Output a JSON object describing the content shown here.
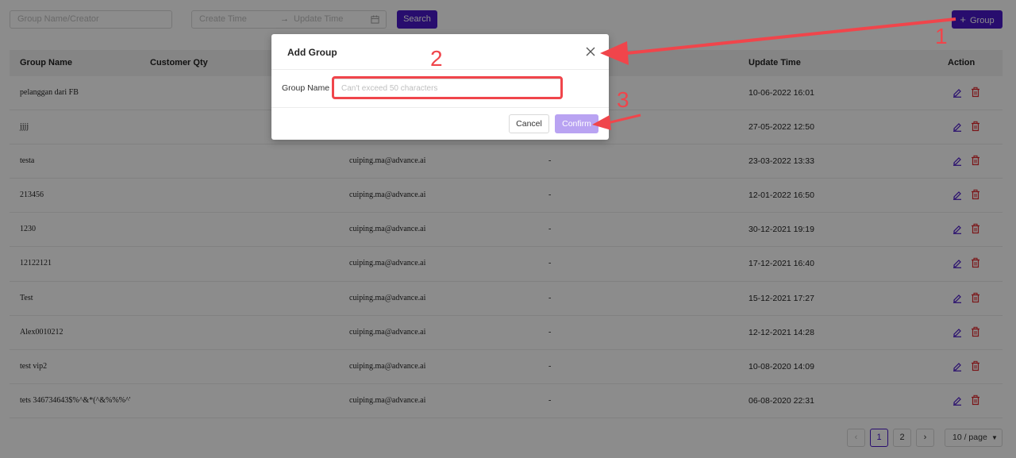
{
  "filters": {
    "name_placeholder": "Group Name/Creator",
    "start_placeholder": "Create Time",
    "separator": "→",
    "end_placeholder": "Update Time",
    "calendar_icon": "calendar-icon",
    "search_label": "Search",
    "add_group_label": "Group",
    "add_icon": "plus-icon"
  },
  "table": {
    "headers": [
      "Group Name",
      "Customer Qty",
      "Update Time",
      "Action"
    ],
    "rows": [
      {
        "name": "pelanggan dari FB",
        "creator": "",
        "remark": "",
        "update_time": "10-06-2022 16:01"
      },
      {
        "name": "jjjj",
        "creator": "",
        "remark": "",
        "update_time": "27-05-2022 12:50"
      },
      {
        "name": "testa",
        "creator": "cuiping.ma@advance.ai",
        "remark": "-",
        "update_time": "23-03-2022 13:33"
      },
      {
        "name": "213456",
        "creator": "cuiping.ma@advance.ai",
        "remark": "-",
        "update_time": "12-01-2022 16:50"
      },
      {
        "name": "1230",
        "creator": "cuiping.ma@advance.ai",
        "remark": "-",
        "update_time": "30-12-2021 19:19"
      },
      {
        "name": "12122121",
        "creator": "cuiping.ma@advance.ai",
        "remark": "-",
        "update_time": "17-12-2021 16:40"
      },
      {
        "name": "Test",
        "creator": "cuiping.ma@advance.ai",
        "remark": "-",
        "update_time": "15-12-2021 17:27"
      },
      {
        "name": "Alex0010212",
        "creator": "cuiping.ma@advance.ai",
        "remark": "-",
        "update_time": "12-12-2021 14:28"
      },
      {
        "name": "test vip2",
        "creator": "cuiping.ma@advance.ai",
        "remark": "-",
        "update_time": "10-08-2020 14:09"
      },
      {
        "name": "tets 346734643$%^&*(^&%%%^'",
        "creator": "cuiping.ma@advance.ai",
        "remark": "-",
        "update_time": "06-08-2020 22:31"
      }
    ],
    "edit_icon": "edit-icon",
    "delete_icon": "trash-icon"
  },
  "pagination": {
    "pages": [
      "1",
      "2"
    ],
    "current": "1",
    "page_size": "10 / page",
    "prev_icon": "chevron-left-icon",
    "next_icon": "chevron-right-icon"
  },
  "modal": {
    "title": "Add Group",
    "field_label": "Group Name",
    "field_placeholder": "Can't exceed 50 characters",
    "cancel_label": "Cancel",
    "confirm_label": "Confirm",
    "close_icon": "close-icon"
  },
  "annotations": {
    "markers": [
      "1",
      "2",
      "3"
    ],
    "color": "#f0454b"
  },
  "colors": {
    "primary": "#4a18c9",
    "confirm_disabled": "#b9a3f2",
    "delete": "#e0262b"
  }
}
